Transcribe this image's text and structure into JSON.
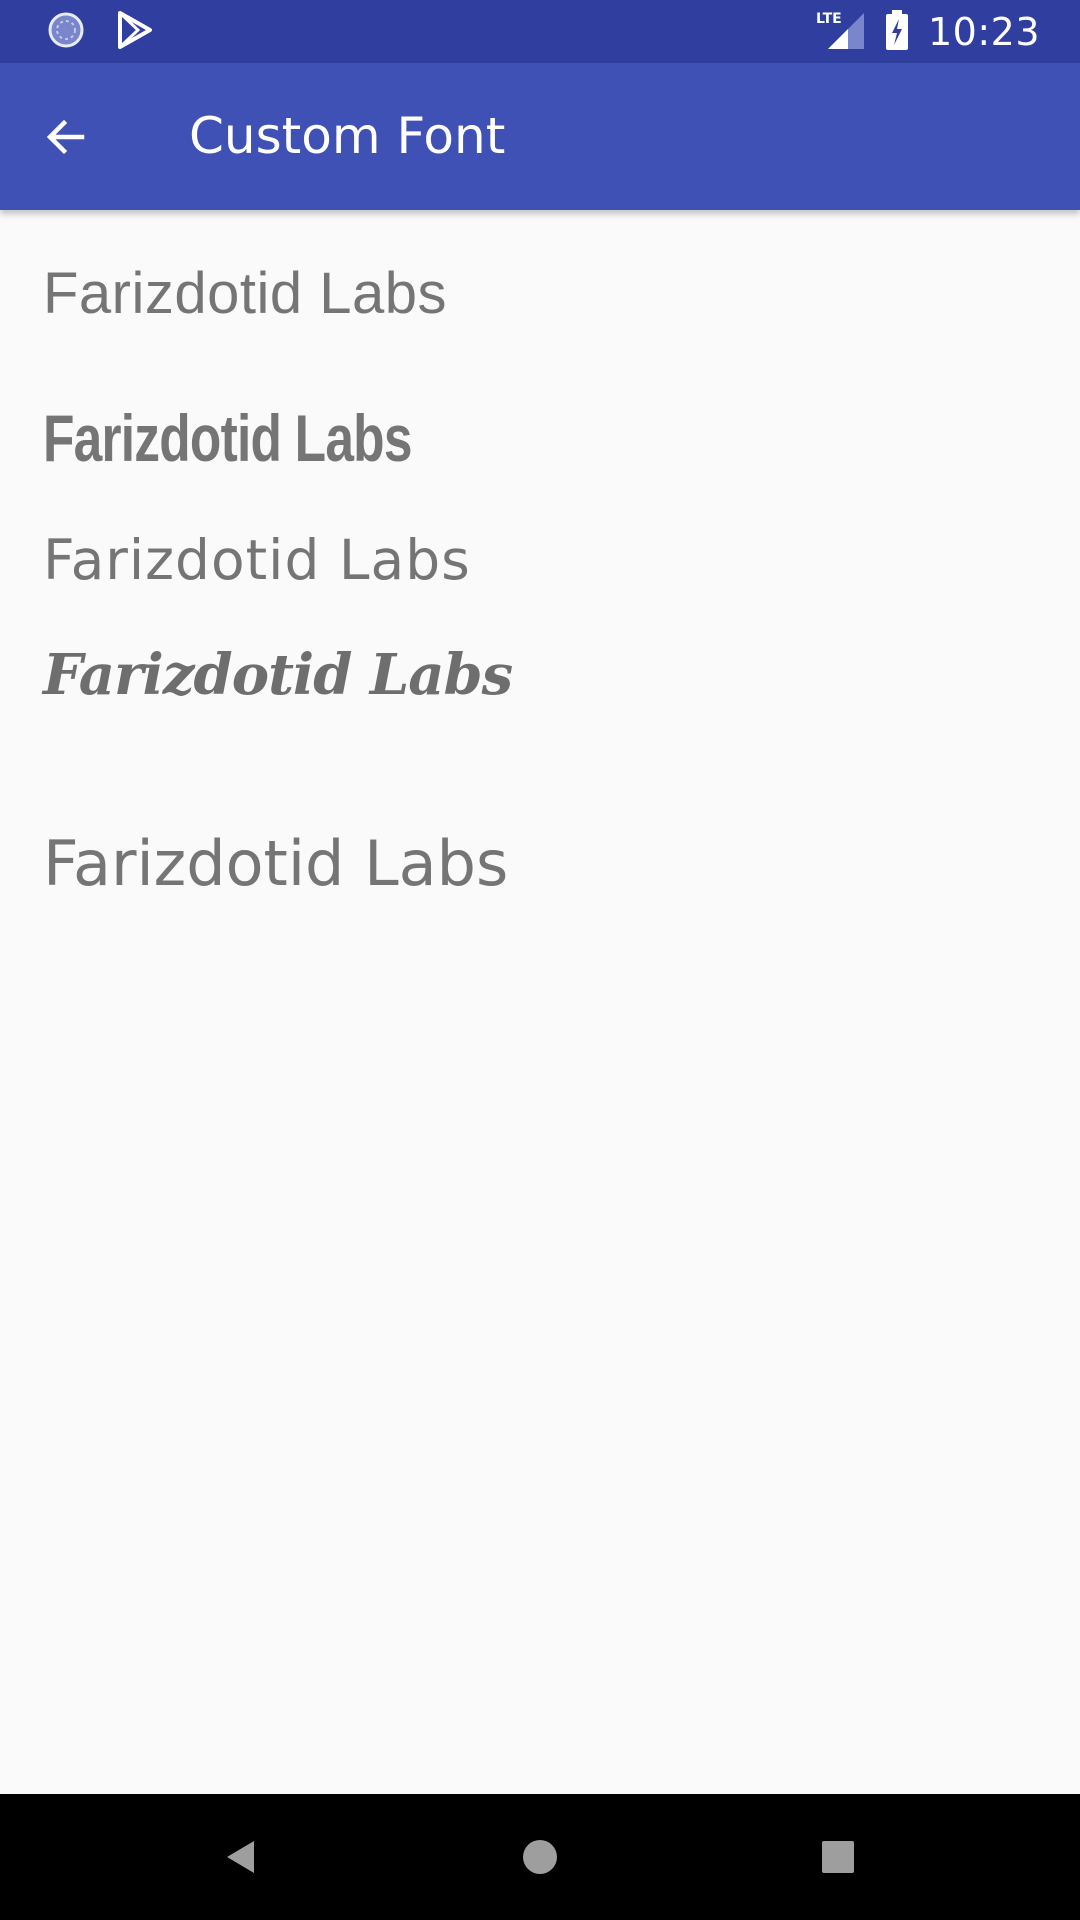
{
  "status_bar": {
    "time": "10:23",
    "network_label": "LTE",
    "icons": [
      "loading-icon",
      "play-store-icon",
      "signal-icon",
      "battery-charging-icon"
    ],
    "background": "#303f9f"
  },
  "app_bar": {
    "title": "Custom Font",
    "back_icon": "arrow-back-icon",
    "background": "#3f51b5"
  },
  "samples": [
    {
      "text": "Farizdotid Labs",
      "style": "light sans"
    },
    {
      "text": "Farizdotid Labs",
      "style": "condensed bold"
    },
    {
      "text": "Farizdotid Labs",
      "style": "regular sans"
    },
    {
      "text": "Farizdotid Labs",
      "style": "script"
    },
    {
      "text": "Farizdotid Labs",
      "style": "sans"
    }
  ],
  "nav_bar": {
    "buttons": [
      "back-triangle-icon",
      "home-circle-icon",
      "recents-square-icon"
    ]
  },
  "colors": {
    "text": "#757575",
    "background": "#fafafa"
  }
}
